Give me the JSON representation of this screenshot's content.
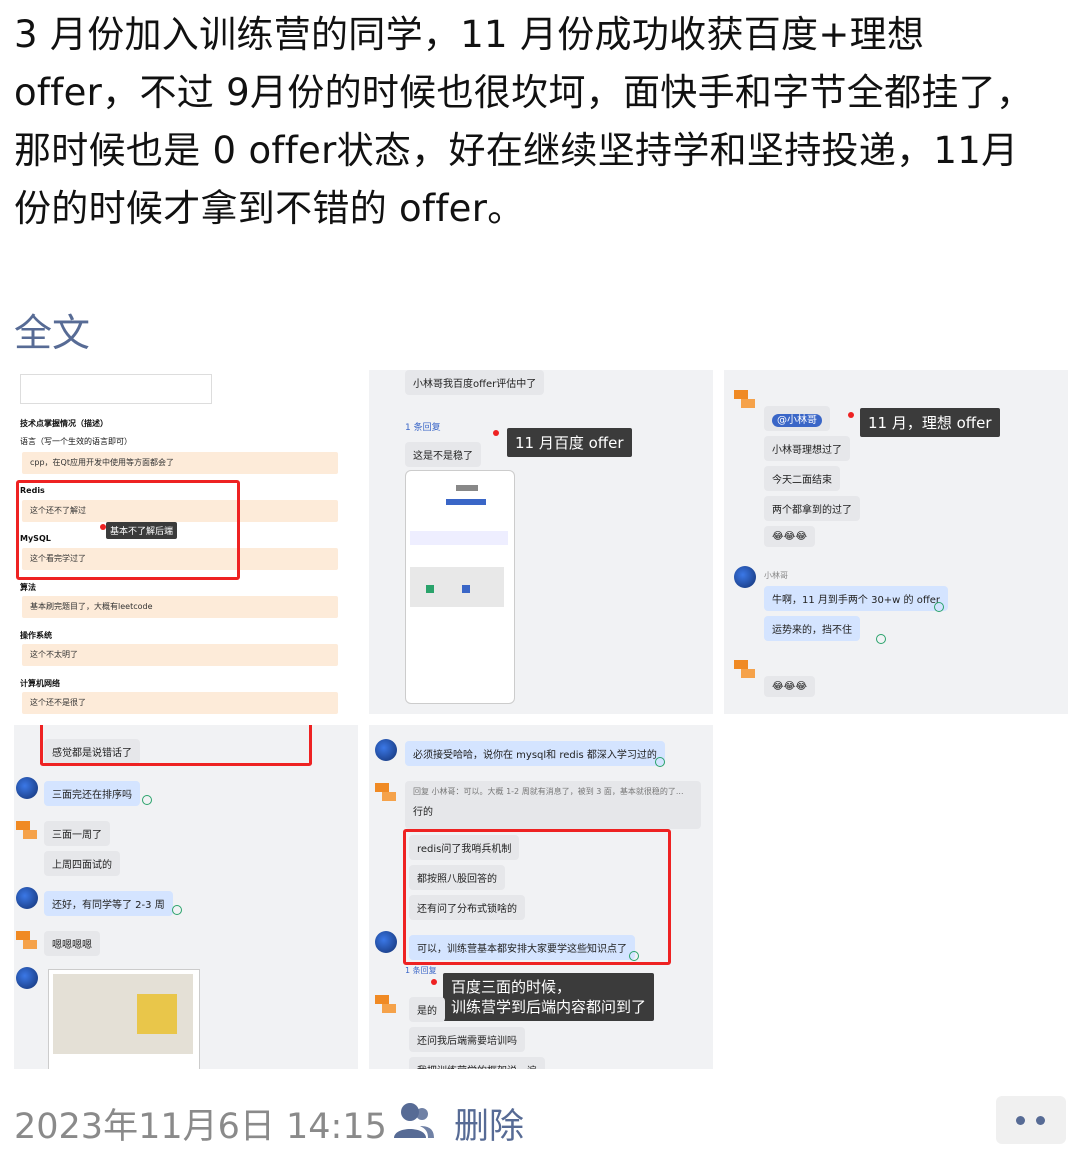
{
  "post": {
    "text": "3 月份加入训练营的同学，11 月份成功收获百度+理想 offer，不过 9月份的时候也很坎坷，面快手和字节全都挂了，那时候也是 0 offer状态，好在继续坚持学和坚持投递，11月份的时候才拿到不错的 offer。",
    "full_text_link": "全文"
  },
  "images": {
    "img1": {
      "sec_title": "技术点掌握情况（描述）",
      "lang_label": "语言（写一个生效的语言即可）",
      "lang_item": "cpp，在Qt应用开发中使用等方面都会了",
      "redis_label": "Redis",
      "redis_item": "这个还不了解过",
      "mysql_label": "MySQL",
      "mysql_item": "这个看完学过了",
      "algo_label": "算法",
      "algo_item": "基本刷完题目了，大概有leetcode",
      "os_label": "操作系统",
      "os_item": "这个不太明了",
      "net_label": "计算机网络",
      "net_item": "这个还不是很了",
      "tip": "基本不了解后端"
    },
    "img2": {
      "msg1": "小林哥我百度offer评估中了",
      "reply_tag": "1 条回复",
      "msg2": "这是不是稳了",
      "tip": "11 月百度 offer"
    },
    "img3": {
      "at": "@小林哥",
      "m1": "小林哥理想过了",
      "m2": "今天二面结束",
      "m3": "两个都拿到的过了",
      "m4": "😂😂😂",
      "name": "小林哥",
      "m5": "牛啊，11 月到手两个 30+w 的 offer",
      "m6": "运势来的，挡不住",
      "m7": "😂😂😂",
      "tip": "11 月，理想 offer"
    },
    "img4": {
      "m0": "感觉都是说错话了",
      "m1": "三面完还在排序吗",
      "m2": "三面一周了",
      "m3": "上周四面试的",
      "m4": "还好，有同学等了 2-3 周",
      "m5": "嗯嗯嗯嗯"
    },
    "img5": {
      "m1": "必须接受哈哈，说你在 mysql和 redis 都深入学习过的",
      "quote": "回复 小林哥：可以。大概 1-2 周就有消息了，被到 3 面，基本就很稳的了...",
      "m2": "行的",
      "m3": "redis问了我哨兵机制",
      "m4": "都按照八股回答的",
      "m5": "还有问了分布式锁啥的",
      "m6": "可以，训练营基本都安排大家要学这些知识点了",
      "reply_tag": "1 条回复",
      "m7": "是的",
      "m8": "还问我后端需要培训吗",
      "m9": "我把训练营学的框架说一遍",
      "tip": "百度三面的时候，\n训练营学到后端内容都问到了"
    }
  },
  "footer": {
    "date": "2023年11月6日 14:15",
    "delete": "删除"
  },
  "colors": {
    "link": "#576b95",
    "highlight_red": "#e22",
    "tooltip_bg": "#3b3b3b"
  }
}
